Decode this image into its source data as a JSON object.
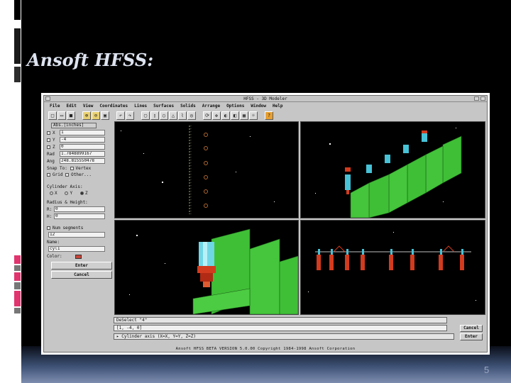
{
  "slide": {
    "title": "Ansoft HFSS:",
    "page_number": "5"
  },
  "app": {
    "window_title": "HFSS - 3D Modeler",
    "menu": [
      "File",
      "Edit",
      "View",
      "Coordinates",
      "Lines",
      "Surfaces",
      "Solids",
      "Arrange",
      "Options",
      "Window",
      "Help"
    ],
    "toolbar_icons": [
      "new-icon",
      "open-icon",
      "save-icon",
      "zoom-in-icon",
      "zoom-out-icon",
      "fit-icon",
      "undo-icon",
      "redo-icon",
      "box-icon",
      "cylinder-icon",
      "sphere-icon",
      "cone-icon",
      "polyline-icon",
      "torus-icon",
      "rotate-icon",
      "pan-icon",
      "view-icon",
      "render-icon",
      "grid-icon",
      "light-icon",
      "snap-icon",
      "help-icon"
    ],
    "left_panel": {
      "units_label": "Abs.[inches]",
      "x_label": "X",
      "x_value": "1",
      "y_label": "Y",
      "y_value": "-4",
      "z_label": "Z",
      "z_value": "0",
      "rad_label": "Rad",
      "rad_value": "1.7848899167",
      "ang_label": "Ang",
      "ang_value": "248.815550478",
      "snap_label": "Snap To:",
      "vertex_label": "Vertex",
      "grid_label": "Grid",
      "other_label": "Other...",
      "cyl_axis_label": "Cylinder Axis:",
      "axis_x": "X",
      "axis_y": "Y",
      "axis_z": "Z",
      "radius_height_label": "Radius & Height:",
      "r_label": "R:",
      "r_value": "0",
      "h_label": "H:",
      "h_value": "0",
      "num_segments_label": "Num segments",
      "segments_value": "12",
      "name_label": "Name:",
      "name_value": "cyl1",
      "color_label": "Color:",
      "enter_button": "Enter",
      "cancel_button": "Cancel"
    },
    "command": {
      "message": "DeSelect \"4\"",
      "input_value": "[1, -4, 0]",
      "prompt": "Cylinder axis (X=X, Y=Y, Z=Z)",
      "cancel_button": "Cancel",
      "enter_button": "Enter"
    },
    "status": "Ansoft HFSS     BETA VERSION 5.0.00     Copyright 1984-1998 Ansoft Corporation"
  },
  "colors": {
    "plate_green": "#3fbf36",
    "cylinder_cyan": "#47c2d6",
    "cylinder_red": "#d23b1e"
  }
}
